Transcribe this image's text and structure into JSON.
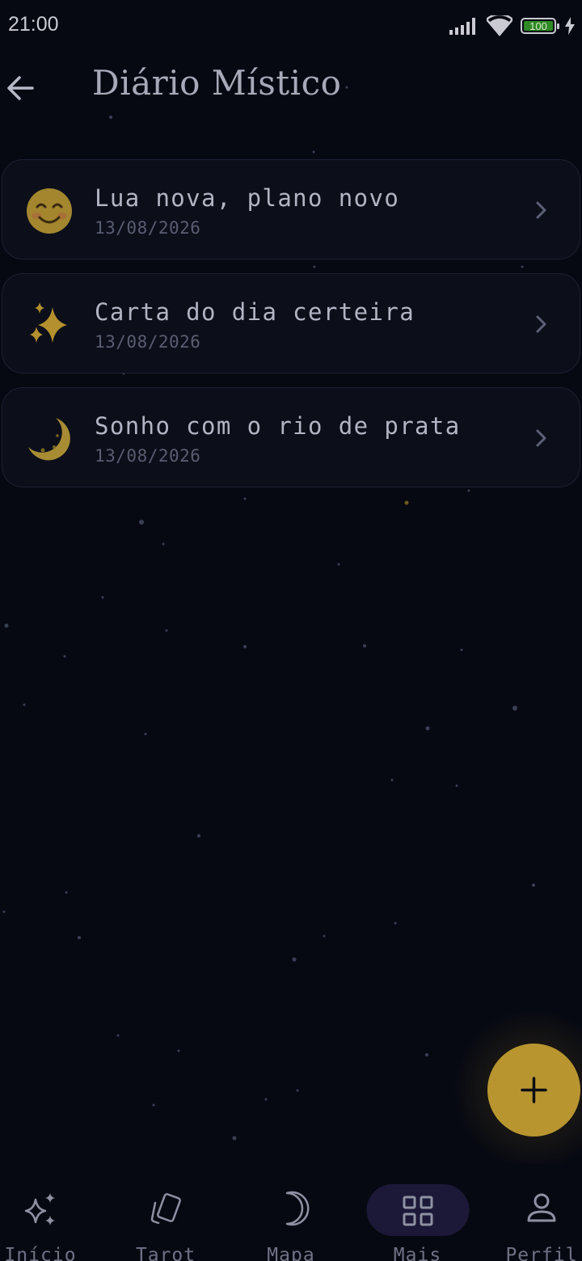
{
  "status_bar": {
    "time": "21:00",
    "battery_level": "100"
  },
  "header": {
    "title": "Diário Místico"
  },
  "entries": [
    {
      "emoji": "smiling-face",
      "title": "Lua nova, plano novo",
      "date": "13/08/2026"
    },
    {
      "emoji": "sparkles",
      "title": "Carta do dia certeira",
      "date": "13/08/2026"
    },
    {
      "emoji": "crescent-moon",
      "title": "Sonho com o rio de prata",
      "date": "13/08/2026"
    }
  ],
  "fab": {
    "icon": "plus-icon"
  },
  "nav": {
    "active": "Mais",
    "items": [
      {
        "label": "Início",
        "icon": "sparkles-icon"
      },
      {
        "label": "Tarot",
        "icon": "cards-icon"
      },
      {
        "label": "Mapa",
        "icon": "moon-icon"
      },
      {
        "label": "Mais",
        "icon": "grid-icon"
      },
      {
        "label": "Perfil",
        "icon": "person-icon"
      }
    ]
  },
  "colors": {
    "background": "#070912",
    "card": "#0c0f1a",
    "accent_gold": "#b8952f",
    "nav_active_pill": "#1c1838"
  }
}
